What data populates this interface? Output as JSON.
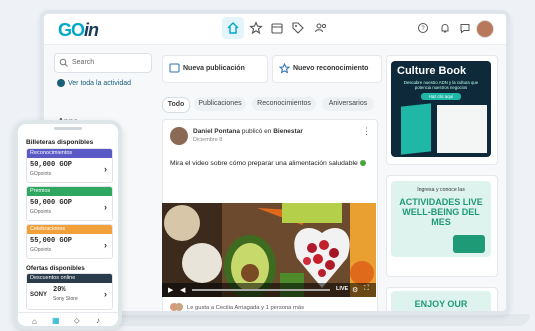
{
  "app": {
    "logo_main": "GO",
    "logo_accent": "in"
  },
  "sidebar": {
    "search_placeholder": "Search",
    "see_all": "Ver toda la actividad",
    "apps_label": "Apps"
  },
  "actions": {
    "new_post": "Nueva publicación",
    "new_recognition": "Nuevo reconocimiento"
  },
  "tabs": [
    {
      "label": "Todo"
    },
    {
      "label": "Publicaciones"
    },
    {
      "label": "Reconocimientos"
    },
    {
      "label": "Aniversarios"
    }
  ],
  "post": {
    "author": "Daniel Pontana",
    "action": " publicó en ",
    "group": "Bienestar",
    "date": "Diciembre 8",
    "text": "Mira el video sobre cómo preparar una alimentación saludable",
    "video_live": "LIVE",
    "likes_text": "Le gusta a Cecilia Arriagada y 1 persona más"
  },
  "promos": {
    "culture_title": "Culture Book",
    "culture_sub": "Descubre nuestro ADN y la cultura que potencia nuestros negocios",
    "culture_btn": "Haz clic aquí",
    "act_intro": "Ingresa y conoce las",
    "act_title": "ACTIVIDADES LIVE WELL-BEING DEL MES",
    "enjoy_title": "ENJOY OUR"
  },
  "phone": {
    "wallets_title": "Billeteras disponibles",
    "wallets": [
      {
        "name": "Reconocimientos",
        "value": "50,000 GOP",
        "sub": "GOpoints",
        "color": "#5b59c6"
      },
      {
        "name": "Premios",
        "value": "50,000 GOP",
        "sub": "GOpoints",
        "color": "#2ea860"
      },
      {
        "name": "Celebraciones",
        "value": "55,000 GOP",
        "sub": "GOpoints",
        "color": "#f2a13a"
      }
    ],
    "offers_title": "Ofertas disponibles",
    "offer": {
      "header": "Descuentos online",
      "brand": "SONY",
      "discount": "20%",
      "store": "Sony Store"
    }
  },
  "colors": {
    "brand": "#00a7c7",
    "navy": "#1b3b5a",
    "culture_bg": "#0e2a3a",
    "culture_accent": "#1fb7a6",
    "act_bg": "#dff3ee",
    "act_green": "#1f9a77"
  }
}
